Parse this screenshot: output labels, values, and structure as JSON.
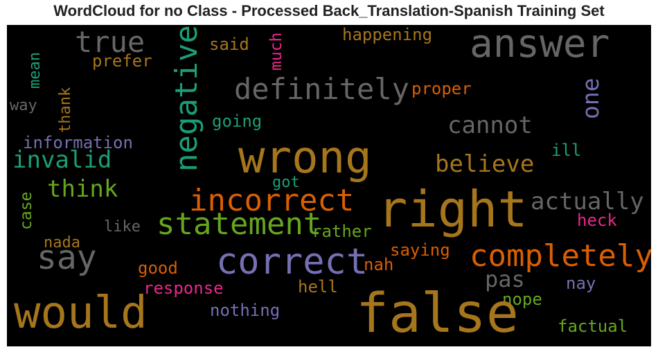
{
  "title": "WordCloud for no Class - Processed Back_Translation-Spanish Training Set",
  "background_color": "#000000",
  "palette": {
    "teal": "#1b9e77",
    "orange": "#d95f02",
    "purple": "#7570b3",
    "pink": "#e7298a",
    "green": "#66a61e",
    "gold": "#a6761d",
    "gray": "#666666"
  },
  "words": [
    {
      "text": "answer",
      "color": "#666666"
    },
    {
      "text": "true",
      "color": "#666666"
    },
    {
      "text": "negative",
      "color": "#1b9e77"
    },
    {
      "text": "said",
      "color": "#a6761d"
    },
    {
      "text": "much",
      "color": "#e7298a"
    },
    {
      "text": "happening",
      "color": "#a6761d"
    },
    {
      "text": "definitely",
      "color": "#666666"
    },
    {
      "text": "prefer",
      "color": "#a6761d"
    },
    {
      "text": "mean",
      "color": "#1b9e77"
    },
    {
      "text": "way",
      "color": "#666666"
    },
    {
      "text": "thank",
      "color": "#a6761d"
    },
    {
      "text": "proper",
      "color": "#d95f02"
    },
    {
      "text": "one",
      "color": "#7570b3"
    },
    {
      "text": "cannot",
      "color": "#666666"
    },
    {
      "text": "going",
      "color": "#1b9e77"
    },
    {
      "text": "information",
      "color": "#7570b3"
    },
    {
      "text": "invalid",
      "color": "#1b9e77"
    },
    {
      "text": "wrong",
      "color": "#a6761d"
    },
    {
      "text": "believe",
      "color": "#a6761d"
    },
    {
      "text": "ill",
      "color": "#1b9e77"
    },
    {
      "text": "got",
      "color": "#1b9e77"
    },
    {
      "text": "think",
      "color": "#66a61e"
    },
    {
      "text": "incorrect",
      "color": "#d95f02"
    },
    {
      "text": "right",
      "color": "#a6761d"
    },
    {
      "text": "actually",
      "color": "#666666"
    },
    {
      "text": "case",
      "color": "#66a61e"
    },
    {
      "text": "statement",
      "color": "#66a61e"
    },
    {
      "text": "like",
      "color": "#666666"
    },
    {
      "text": "rather",
      "color": "#66a61e"
    },
    {
      "text": "heck",
      "color": "#e7298a"
    },
    {
      "text": "nada",
      "color": "#a6761d"
    },
    {
      "text": "say",
      "color": "#666666"
    },
    {
      "text": "correct",
      "color": "#7570b3"
    },
    {
      "text": "saying",
      "color": "#d95f02"
    },
    {
      "text": "completely",
      "color": "#d95f02"
    },
    {
      "text": "nah",
      "color": "#d95f02"
    },
    {
      "text": "good",
      "color": "#d95f02"
    },
    {
      "text": "pas",
      "color": "#666666"
    },
    {
      "text": "response",
      "color": "#e7298a"
    },
    {
      "text": "hell",
      "color": "#a6761d"
    },
    {
      "text": "nay",
      "color": "#7570b3"
    },
    {
      "text": "nope",
      "color": "#66a61e"
    },
    {
      "text": "would",
      "color": "#a6761d"
    },
    {
      "text": "nothing",
      "color": "#7570b3"
    },
    {
      "text": "false",
      "color": "#a6761d"
    },
    {
      "text": "factual",
      "color": "#66a61e"
    }
  ]
}
